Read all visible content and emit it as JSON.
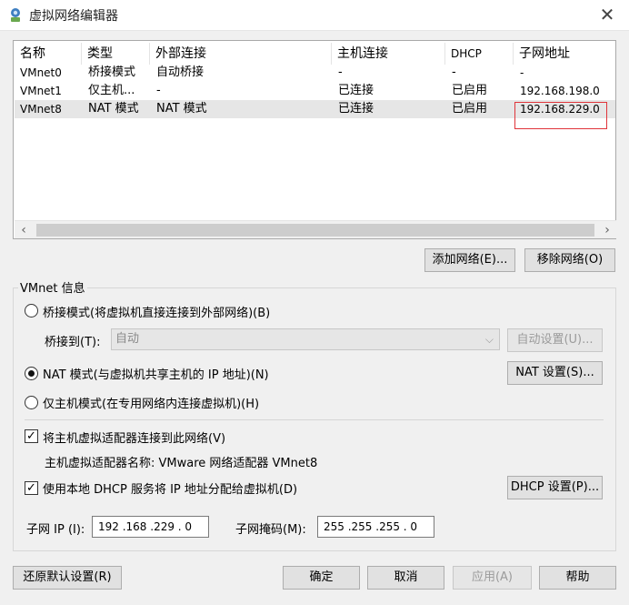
{
  "window": {
    "title": "虚拟网络编辑器",
    "icon": "vmware-network-icon"
  },
  "table": {
    "columns": [
      "名称",
      "类型",
      "外部连接",
      "主机连接",
      "DHCP",
      "子网地址"
    ],
    "rows": [
      [
        "VMnet0",
        "桥接模式",
        "自动桥接",
        "-",
        "-",
        "-"
      ],
      [
        "VMnet1",
        "仅主机...",
        "-",
        "已连接",
        "已启用",
        "192.168.198.0"
      ],
      [
        "VMnet8",
        "NAT 模式",
        "NAT 模式",
        "已连接",
        "已启用",
        "192.168.229.0"
      ]
    ],
    "selected_row": 2,
    "highlight_color": "#e0343a"
  },
  "buttons": {
    "add_network": "添加网络(E)...",
    "remove_network": "移除网络(O)",
    "auto_settings": "自动设置(U)...",
    "nat_settings": "NAT 设置(S)...",
    "dhcp_settings": "DHCP 设置(P)...",
    "restore_defaults": "还原默认设置(R)",
    "ok": "确定",
    "cancel": "取消",
    "apply": "应用(A)",
    "help": "帮助"
  },
  "vmnet_info": {
    "title": "VMnet 信息",
    "bridged_label": "桥接模式(将虚拟机直接连接到外部网络)(B)",
    "bridged_to_label": "桥接到(T):",
    "bridged_to_value": "自动",
    "nat_label": "NAT 模式(与虚拟机共享主机的 IP 地址)(N)",
    "hostonly_label": "仅主机模式(在专用网络内连接虚拟机)(H)",
    "selected_mode": "nat",
    "connect_adapter_label": "将主机虚拟适配器连接到此网络(V)",
    "connect_adapter_checked": true,
    "adapter_name_text": "主机虚拟适配器名称: VMware 网络适配器 VMnet8",
    "use_dhcp_label": "使用本地 DHCP 服务将 IP 地址分配给虚拟机(D)",
    "use_dhcp_checked": true,
    "subnet_ip_label": "子网 IP (I):",
    "subnet_ip_value": "192 .168 .229 .  0",
    "subnet_mask_label": "子网掩码(M):",
    "subnet_mask_value": "255 .255 .255 .  0"
  },
  "icons": {
    "close": "close-icon",
    "scroll_left": "chevron-left-icon",
    "scroll_right": "chevron-right-icon",
    "dropdown": "chevron-down-icon",
    "check": "check-icon"
  }
}
